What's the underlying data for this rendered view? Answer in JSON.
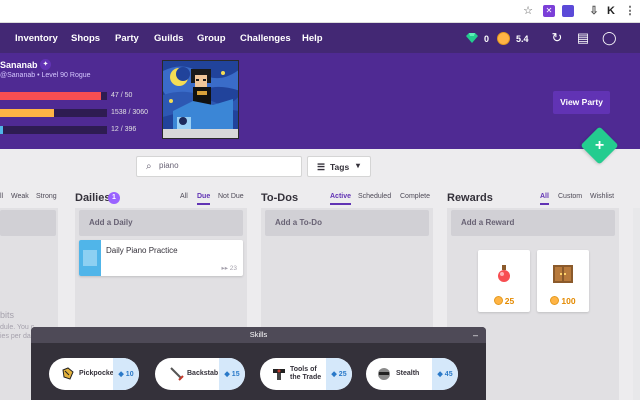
{
  "nav": {
    "items": [
      "Inventory",
      "Shops",
      "Party",
      "Guilds",
      "Group",
      "Challenges",
      "Help"
    ],
    "gems": "0",
    "gold": "5.4"
  },
  "header": {
    "user_name": "Sananab",
    "user_sub": "@Sananab • Level 90 Rogue",
    "bars": [
      {
        "value": "47 / 50",
        "fraction": 0.94,
        "color": "#f74e52"
      },
      {
        "value": "1538 / 3060",
        "fraction": 0.5,
        "color": "#ffb445"
      },
      {
        "value": "12 / 396",
        "fraction": 0.03,
        "color": "#50b5e9"
      }
    ],
    "view_party": "View Party",
    "fab_plus": "+"
  },
  "search": {
    "value": "piano",
    "tags_label": "Tags"
  },
  "habits": {
    "filters": [
      "ll",
      "Weak",
      "Strong"
    ],
    "faded_title": "bits",
    "faded_lines": [
      "dule. You c",
      "ies per da"
    ]
  },
  "dailies": {
    "title": "Dailies",
    "count": "1",
    "filters": [
      "All",
      "Due",
      "Not Due"
    ],
    "active_filter": "Due",
    "add_label": "Add a Daily",
    "cards": [
      {
        "title": "Daily Piano Practice",
        "streak": "▸▸ 23"
      }
    ]
  },
  "todos": {
    "title": "To-Dos",
    "filters": [
      "Active",
      "Scheduled",
      "Complete"
    ],
    "active_filter": "Active",
    "add_label": "Add a To-Do"
  },
  "rewards": {
    "title": "Rewards",
    "filters": [
      "All",
      "Custom",
      "Wishlist"
    ],
    "active_filter": "All",
    "add_label": "Add a Reward",
    "items": [
      {
        "name": "health-potion",
        "cost": "25"
      },
      {
        "name": "armoire",
        "cost": "100"
      }
    ]
  },
  "skills": {
    "title": "Skills",
    "minimize": "–",
    "items": [
      {
        "name": "Pickpocket",
        "cost": "10"
      },
      {
        "name": "Backstab",
        "cost": "15"
      },
      {
        "name": "Tools of the Trade",
        "cost": "25"
      },
      {
        "name": "Stealth",
        "cost": "45"
      }
    ]
  },
  "colors": {
    "nav_bg": "#432874",
    "header_bg": "#4f2a93",
    "accent": "#6133b4",
    "fab": "#24cc8f",
    "daily_blue": "#50b5e9"
  }
}
